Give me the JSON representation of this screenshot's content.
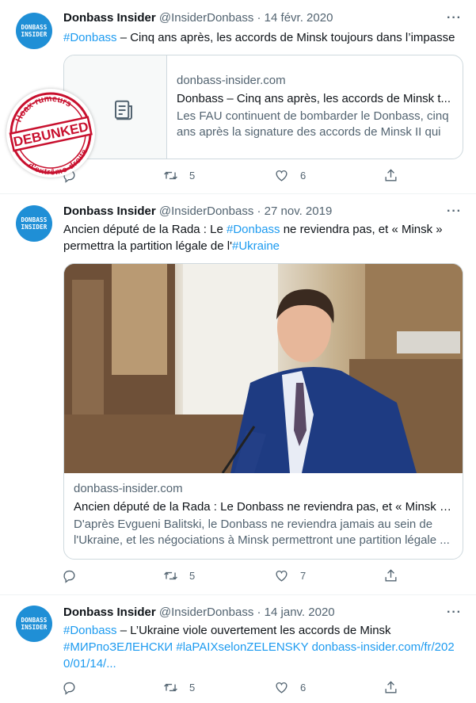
{
  "tweets": [
    {
      "avatar": {
        "line1": "DONBASS",
        "line2": "INSIDER"
      },
      "name": "Donbass Insider",
      "handle": "@InsiderDonbass",
      "sep": "·",
      "date": "14 févr. 2020",
      "text": {
        "hashtag": "#Donbass",
        "rest": " – Cinq ans après, les accords de Minsk toujours dans l’impasse"
      },
      "card": {
        "domain": "donbass-insider.com",
        "title": "Donbass – Cinq ans après, les accords de Minsk t...",
        "desc": "Les FAU continuent de bombarder le Donbass, cinq ans après la signature des accords de Minsk II qui ..."
      },
      "retweets": "5",
      "likes": "6"
    },
    {
      "avatar": {
        "line1": "DONBASS",
        "line2": "INSIDER"
      },
      "name": "Donbass Insider",
      "handle": "@InsiderDonbass",
      "sep": "·",
      "date": "27 nov. 2019",
      "text": {
        "part1": "Ancien député de la Rada : Le ",
        "hashtag1": "#Donbass",
        "part2": " ne reviendra pas, et « Minsk » permettra la partition légale de l'",
        "hashtag2": "#Ukraine"
      },
      "card": {
        "domain": "donbass-insider.com",
        "title": "Ancien député de la Rada : Le Donbass ne reviendra pas, et « Minsk » ...",
        "desc": "D'après Evgueni Balitski, le Donbass ne reviendra jamais au sein de l'Ukraine, et les négociations à Minsk permettront une partition légale ..."
      },
      "retweets": "5",
      "likes": "7"
    },
    {
      "avatar": {
        "line1": "DONBASS",
        "line2": "INSIDER"
      },
      "name": "Donbass Insider",
      "handle": "@InsiderDonbass",
      "sep": "·",
      "date": "14 janv. 2020",
      "text": {
        "hashtag": "#Donbass",
        "rest": " – L’Ukraine viole ouvertement les accords de Minsk",
        "hashtag2": "#МИРпоЗЕЛЕНСКИ",
        "hashtag3": "#laPAIXselonZELENSKY",
        "url": "donbass-insider.com/fr/2020/01/14/..."
      },
      "retweets": "5",
      "likes": "6"
    }
  ],
  "stamp": {
    "top": "Hoax-rumeurs",
    "middle": "DEBUNKED",
    "bottom": "d'extrême-droite"
  },
  "colors": {
    "link": "#1d9bf0",
    "muted": "#536471",
    "stamp": "#c8102e",
    "avatar": "#1f8fd6"
  }
}
